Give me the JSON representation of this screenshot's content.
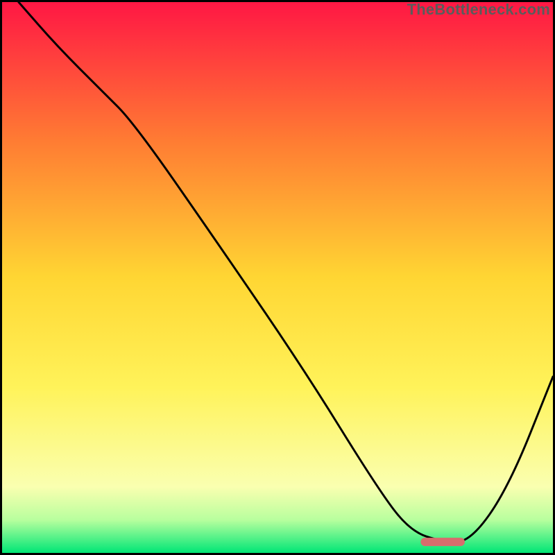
{
  "watermark": "TheBottleneck.com",
  "chart_data": {
    "type": "line",
    "title": "",
    "xlabel": "",
    "ylabel": "",
    "x_range": [
      0,
      100
    ],
    "y_range": [
      0,
      100
    ],
    "grid": false,
    "legend": false,
    "background": "rainbow-gradient",
    "gradient_stops": [
      {
        "pos": 0.0,
        "color": "#ff1744"
      },
      {
        "pos": 0.25,
        "color": "#ff7b33"
      },
      {
        "pos": 0.5,
        "color": "#ffd633"
      },
      {
        "pos": 0.7,
        "color": "#fff35a"
      },
      {
        "pos": 0.88,
        "color": "#faffb0"
      },
      {
        "pos": 0.94,
        "color": "#b8ff9e"
      },
      {
        "pos": 1.0,
        "color": "#00e676"
      }
    ],
    "series": [
      {
        "name": "bottleneck-curve",
        "x": [
          3,
          10,
          18,
          24,
          40,
          55,
          68,
          74,
          80,
          85,
          92,
          100
        ],
        "y": [
          100,
          92,
          84,
          78,
          55,
          33,
          12,
          4,
          2,
          2,
          12,
          32
        ]
      }
    ],
    "marker": {
      "name": "sweet-spot",
      "x": 80,
      "y": 2,
      "width": 8,
      "color": "#d86d6d"
    }
  }
}
